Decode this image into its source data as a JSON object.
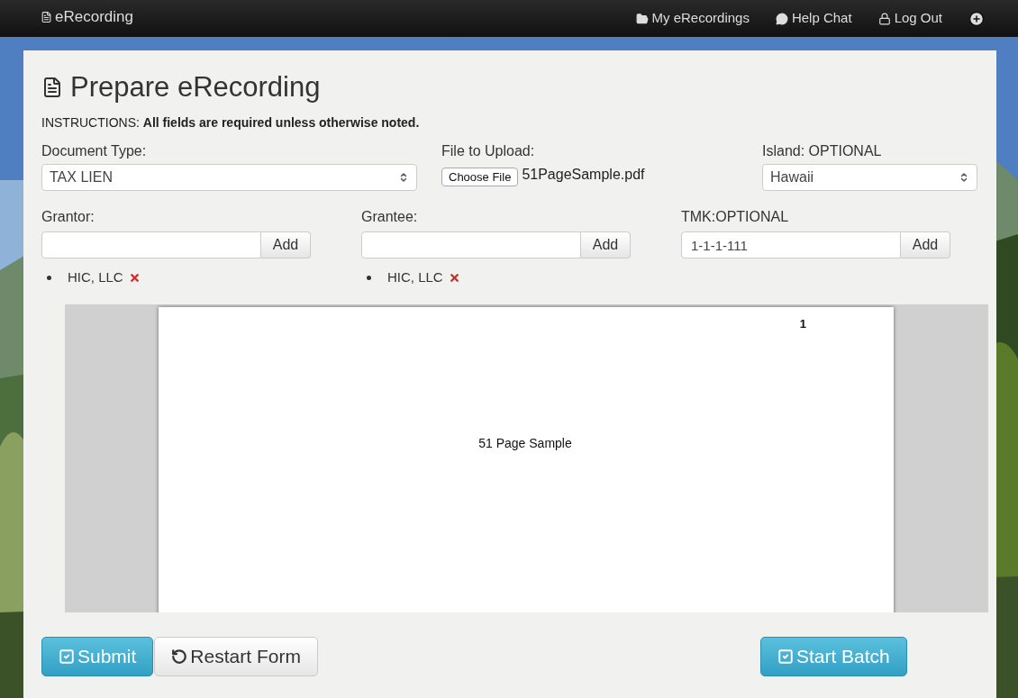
{
  "navbar": {
    "brand": "eRecording",
    "links": [
      {
        "kind": "folder",
        "label": "My eRecordings"
      },
      {
        "kind": "chat",
        "label": "Help Chat"
      },
      {
        "kind": "lock",
        "label": "Log Out"
      }
    ]
  },
  "title": "Prepare eRecording",
  "instructions": {
    "label": "INSTRUCTIONS:",
    "text": "All fields are required unless otherwise noted."
  },
  "document_type": {
    "label": "Document Type:",
    "value": "TAX LIEN"
  },
  "file_upload": {
    "label": "File to Upload:",
    "button": "Choose File",
    "file_name": "51PageSample.pdf"
  },
  "island": {
    "label": "Island: OPTIONAL",
    "value": "Hawaii"
  },
  "party_fields": [
    {
      "label": "Grantor:",
      "button": "Add",
      "items": [
        "HIC, LLC"
      ]
    },
    {
      "label": "Grantee:",
      "button": "Add",
      "items": [
        "HIC, LLC"
      ]
    },
    {
      "label": "TMK:OPTIONAL",
      "value": "1-1-1-111",
      "button": "Add"
    }
  ],
  "preview": {
    "page_number": "1",
    "page_text": "51 Page Sample"
  },
  "actions": {
    "left": [
      {
        "kind": "confirm",
        "label": "Submit"
      },
      {
        "kind": "reset",
        "label": "Restart Form"
      }
    ],
    "right": [
      {
        "kind": "confirm",
        "label": "Start Batch"
      }
    ]
  }
}
